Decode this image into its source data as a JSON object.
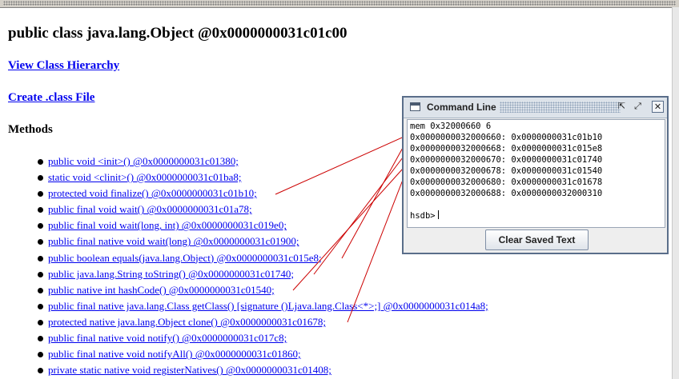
{
  "page": {
    "title": "public class java.lang.Object @0x0000000031c01c00",
    "links": {
      "hierarchy": "View Class Hierarchy",
      "create_class_file": "Create .class File"
    },
    "methods_heading": "Methods",
    "methods": [
      "public void <init>() @0x0000000031c01380;",
      "static void <clinit>() @0x0000000031c01ba8;",
      "protected void finalize() @0x0000000031c01b10;",
      "public final void wait() @0x0000000031c01a78;",
      "public final void wait(long, int) @0x0000000031c019e0;",
      "public final native void wait(long) @0x0000000031c01900;",
      "public boolean equals(java.lang.Object) @0x0000000031c015e8;",
      "public java.lang.String toString() @0x0000000031c01740;",
      "public native int hashCode() @0x0000000031c01540;",
      "public final native java.lang.Class getClass() [signature ()Ljava.lang.Class<*>;] @0x0000000031c014a8;",
      "protected native java.lang.Object clone() @0x0000000031c01678;",
      "public final native void notify() @0x0000000031c017c8;",
      "public final native void notifyAll() @0x0000000031c01860;",
      "private static native void registerNatives() @0x0000000031c01408;"
    ]
  },
  "command_window": {
    "title": "Command Line",
    "buttons": {
      "minimize": "⇱",
      "maximize": "⤢",
      "close": "✕"
    },
    "output_lines": [
      "mem 0x32000660 6",
      "0x0000000032000660: 0x0000000031c01b10",
      "0x0000000032000668: 0x0000000031c015e8",
      "0x0000000032000670: 0x0000000031c01740",
      "0x0000000032000678: 0x0000000031c01540",
      "0x0000000032000680: 0x0000000031c01678",
      "0x0000000032000688: 0x0000000032000310"
    ],
    "prompt": "hsdb>",
    "clear_button": "Clear Saved Text"
  },
  "colors": {
    "link": "#0000ee",
    "annotation_line": "#cc0000"
  }
}
